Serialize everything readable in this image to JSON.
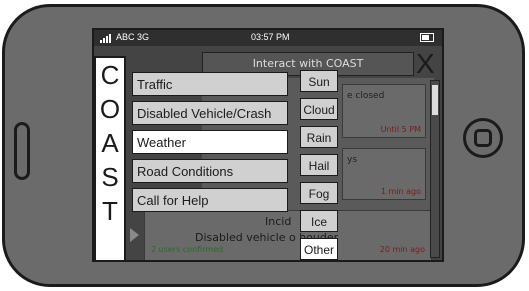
{
  "status_bar": {
    "carrier": "ABC 3G",
    "time": "03:57 PM"
  },
  "header": {
    "title": "Interact with COAST"
  },
  "brand_letters": [
    "C",
    "O",
    "A",
    "S",
    "T"
  ],
  "menu": {
    "items": [
      "Traffic",
      "Disabled Vehicle/Crash",
      "Weather",
      "Road Conditions",
      "Call for Help"
    ],
    "selected": "Weather"
  },
  "submenu": {
    "items": [
      "Sun",
      "Cloud",
      "Rain",
      "Hail",
      "Fog",
      "Ice",
      "Other"
    ],
    "selected": "Other"
  },
  "background_cards": [
    {
      "text": "e closed",
      "meta": "Until 5 PM"
    },
    {
      "text": "ys",
      "meta": "1 min ago"
    }
  ],
  "incident_card": {
    "title": "Incid",
    "description": "Disabled vehicle o        houder",
    "confirmations": "2 users confirmed",
    "age": "20 min ago"
  },
  "colors": {
    "bezel": "#6b6b6b",
    "screen": "#444444",
    "menu_bg": "#d0d0d0",
    "selected": "#ffffff"
  }
}
